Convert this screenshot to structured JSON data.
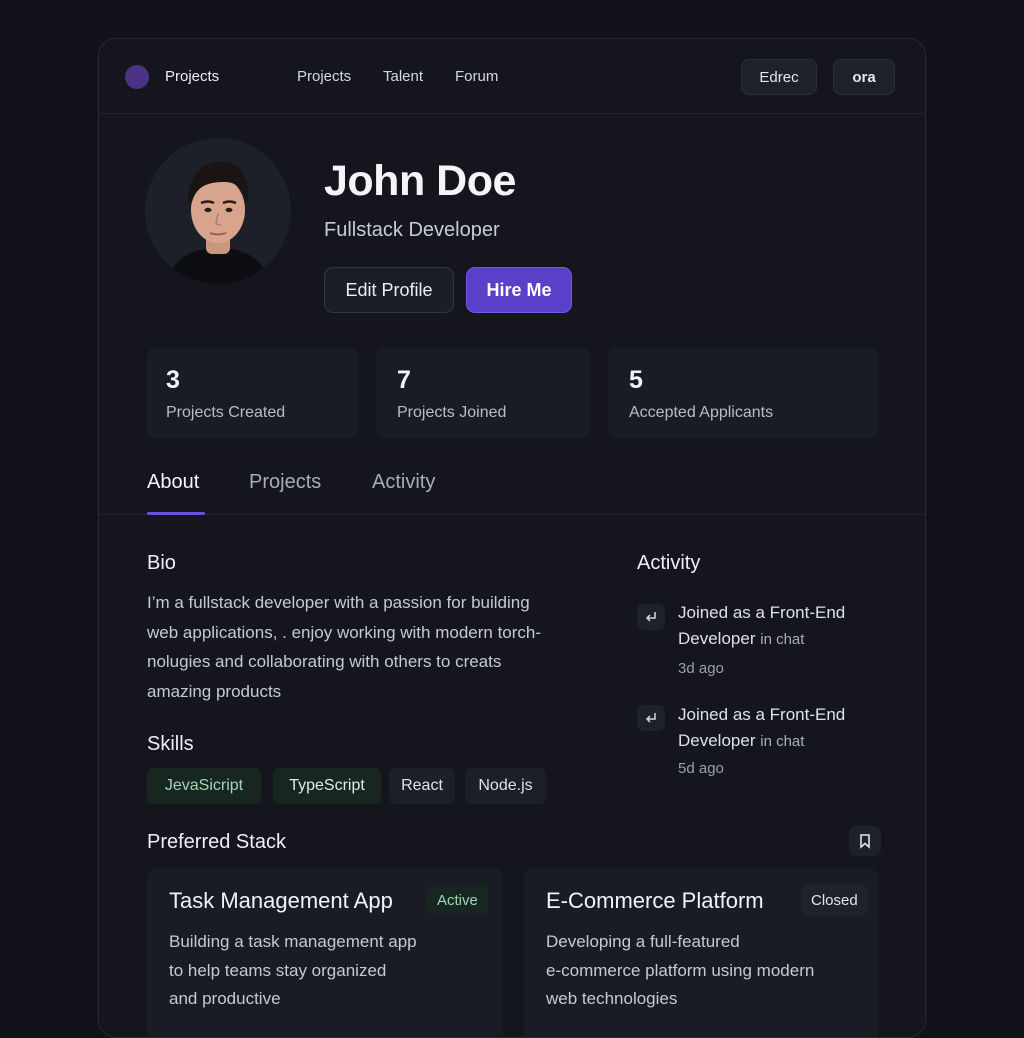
{
  "nav": {
    "brand": "Projects",
    "links": [
      "Projects",
      "Talent",
      "Forum"
    ],
    "buttons": [
      "Edrec",
      "ora"
    ]
  },
  "profile": {
    "name": "John Doe",
    "role": "Fullstack Developer",
    "edit_label": "Edit Profile",
    "hire_label": "Hire Me"
  },
  "stats": [
    {
      "value": "3",
      "label": "Projects Created"
    },
    {
      "value": "7",
      "label": "Projects Joined"
    },
    {
      "value": "5",
      "label": "Accepted Applicants"
    }
  ],
  "tabs": [
    {
      "label": "About",
      "active": true
    },
    {
      "label": "Projects",
      "active": false
    },
    {
      "label": "Activity",
      "active": false
    }
  ],
  "bio": {
    "heading": "Bio",
    "lines": [
      "I’m a fullstack developer with a passion for building",
      "web applications, . enjoy working with modern torch-",
      "nolugies and collaborating with others to creats",
      "amazing products"
    ]
  },
  "skills": {
    "heading": "Skills",
    "items": [
      "JevaSicript",
      "TypeScript",
      "React",
      "Node.js"
    ]
  },
  "activity": {
    "heading": "Activity",
    "items": [
      {
        "line1": "Joined as a Front-End",
        "line2": "Developer",
        "context": "in chat",
        "time": "3d ago",
        "icon": "return-arrow-icon"
      },
      {
        "line1": "Joined as a Front-End",
        "line2": "Developer",
        "context": "in chat",
        "time": "5d ago",
        "icon": "return-arrow-icon"
      }
    ]
  },
  "stack": {
    "heading": "Preferred Stack",
    "projects": [
      {
        "title": "Task Management App",
        "status": "Active",
        "desc_lines": [
          "Building a task management app",
          "to help teams stay organized",
          "and productive"
        ]
      },
      {
        "title": "E-Commerce Platform",
        "status": "Closed",
        "desc_lines": [
          "Developing a full-featured",
          "e-commerce platform using modern",
          "web technologies"
        ]
      }
    ]
  },
  "colors": {
    "accent": "#5a3fc8",
    "background": "#12131a",
    "active_badge": "#9fd7b6"
  }
}
